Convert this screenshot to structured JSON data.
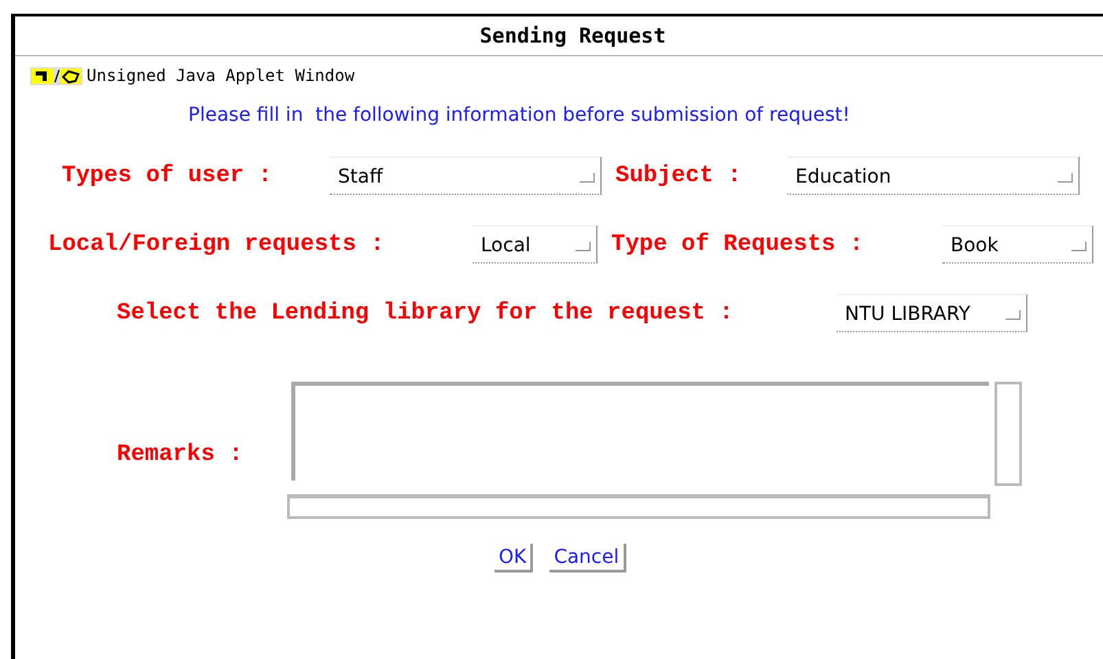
{
  "window": {
    "title": "Sending Request"
  },
  "applet_warning": "Unsigned Java Applet Window",
  "instruction": "Please fill in  the following information before submission of request!",
  "rows": [
    [
      {
        "label": "Types of user :",
        "value": "Staff"
      },
      {
        "label": "Subject :",
        "value": "Education"
      }
    ],
    [
      {
        "label": "Local/Foreign requests :",
        "value": "Local"
      },
      {
        "label": "Type of Requests :",
        "value": "Book"
      }
    ],
    [
      {
        "label": "Select the Lending library for the request :",
        "value": "NTU LIBRARY"
      }
    ]
  ],
  "remarks": {
    "label": "Remarks :"
  },
  "buttons": [
    "OK",
    "Cancel"
  ]
}
